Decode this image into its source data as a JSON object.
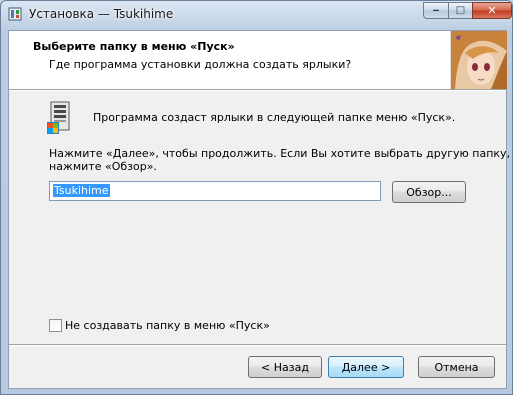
{
  "window": {
    "title": "Установка — Tsukihime",
    "controls": {
      "minimize": "‒",
      "maximize": "□",
      "close": "✕"
    }
  },
  "header": {
    "title": "Выберите папку в меню «Пуск»",
    "subtitle": "Где программа установки должна создать ярлыки?"
  },
  "body": {
    "info": "Программа создаст ярлыки в следующей папке меню «Пуск».",
    "instruction_line1": "Нажмите «Далее», чтобы продолжить. Если Вы хотите выбрать другую папку,",
    "instruction_line2": "нажмите «Обзор».",
    "folder_value": "Tsukihime",
    "browse_label": "Обзор...",
    "no_folder_checkbox": {
      "label": "Не создавать папку в меню «Пуск»",
      "checked": false
    }
  },
  "buttons": {
    "back": "< Назад",
    "next": "Далее >",
    "cancel": "Отмена"
  },
  "colors": {
    "accent_selection": "#3399ff",
    "default_button_border": "#3c7fb1"
  }
}
